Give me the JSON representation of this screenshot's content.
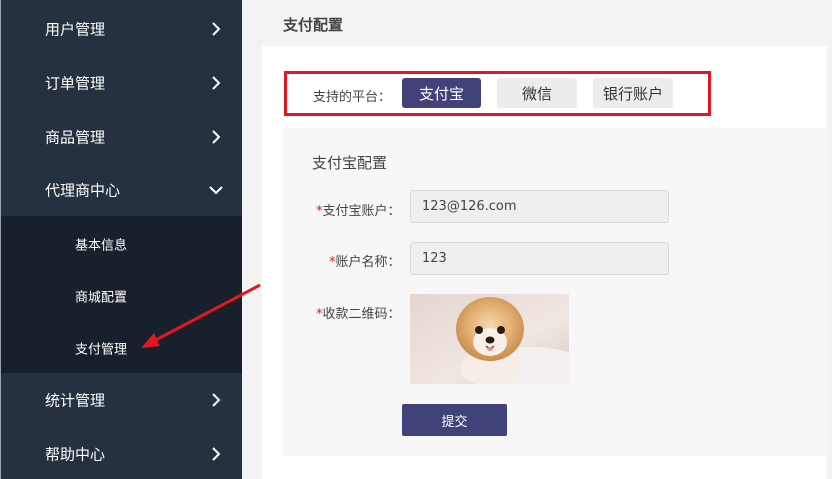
{
  "sidebar": {
    "items": [
      {
        "label": "用户管理",
        "chevron": "chevron-right-icon"
      },
      {
        "label": "订单管理",
        "chevron": "chevron-right-icon"
      },
      {
        "label": "商品管理",
        "chevron": "chevron-right-icon"
      },
      {
        "label": "代理商中心",
        "chevron": "chevron-down-icon"
      },
      {
        "label": "统计管理",
        "chevron": "chevron-right-icon"
      },
      {
        "label": "帮助中心",
        "chevron": "chevron-right-icon"
      }
    ],
    "subitems": [
      {
        "label": "基本信息"
      },
      {
        "label": "商城配置"
      },
      {
        "label": "支付管理"
      }
    ]
  },
  "page": {
    "title": "支付配置"
  },
  "platforms": {
    "label": "支持的平台：",
    "tabs": [
      {
        "label": "支付宝",
        "active": true
      },
      {
        "label": "微信",
        "active": false
      },
      {
        "label": "银行账户",
        "active": false
      }
    ]
  },
  "form": {
    "section_title": "支付宝配置",
    "required_mark": "*",
    "account_label": "支付宝账户：",
    "account_value": "123@126.com",
    "name_label": "账户名称：",
    "name_value": "123",
    "qr_label": "收款二维码：",
    "submit_label": "提交"
  },
  "colors": {
    "sidebar_bg": "#25313f",
    "sidebar_sub_bg": "#18212b",
    "accent": "#42427a",
    "highlight_red": "#e5161f"
  },
  "icons": {
    "annotation_arrow": "red-arrow-icon"
  }
}
